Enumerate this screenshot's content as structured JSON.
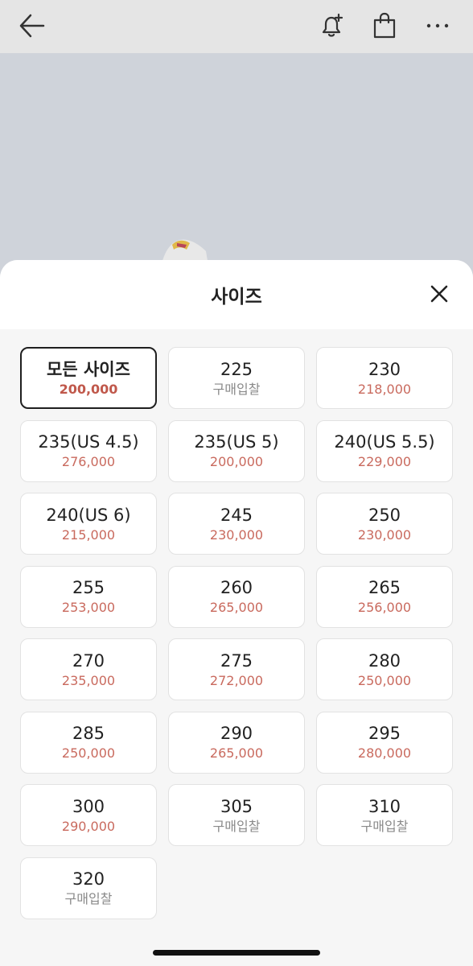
{
  "header": {
    "back_icon": "arrow-left-icon",
    "bell_icon": "bell-plus-icon",
    "bag_icon": "shopping-bag-icon",
    "more_icon": "more-horizontal-icon"
  },
  "sheet": {
    "title": "사이즈",
    "close_icon": "close-icon"
  },
  "sizes": [
    {
      "size": "모든 사이즈",
      "price": "200,000",
      "selected": true
    },
    {
      "size": "225",
      "price": "구매입찰"
    },
    {
      "size": "230",
      "price": "218,000"
    },
    {
      "size": "235(US 4.5)",
      "price": "276,000"
    },
    {
      "size": "235(US 5)",
      "price": "200,000"
    },
    {
      "size": "240(US 5.5)",
      "price": "229,000"
    },
    {
      "size": "240(US 6)",
      "price": "215,000"
    },
    {
      "size": "245",
      "price": "230,000"
    },
    {
      "size": "250",
      "price": "230,000"
    },
    {
      "size": "255",
      "price": "253,000"
    },
    {
      "size": "260",
      "price": "265,000"
    },
    {
      "size": "265",
      "price": "256,000"
    },
    {
      "size": "270",
      "price": "235,000"
    },
    {
      "size": "275",
      "price": "272,000"
    },
    {
      "size": "280",
      "price": "250,000"
    },
    {
      "size": "285",
      "price": "250,000"
    },
    {
      "size": "290",
      "price": "265,000"
    },
    {
      "size": "295",
      "price": "280,000"
    },
    {
      "size": "300",
      "price": "290,000"
    },
    {
      "size": "305",
      "price": "구매입찰"
    },
    {
      "size": "310",
      "price": "구매입찰"
    },
    {
      "size": "320",
      "price": "구매입찰"
    }
  ],
  "colors": {
    "price": "#c96a5e",
    "bid": "#8a8a8a",
    "selected_border": "#1f1f1f"
  }
}
